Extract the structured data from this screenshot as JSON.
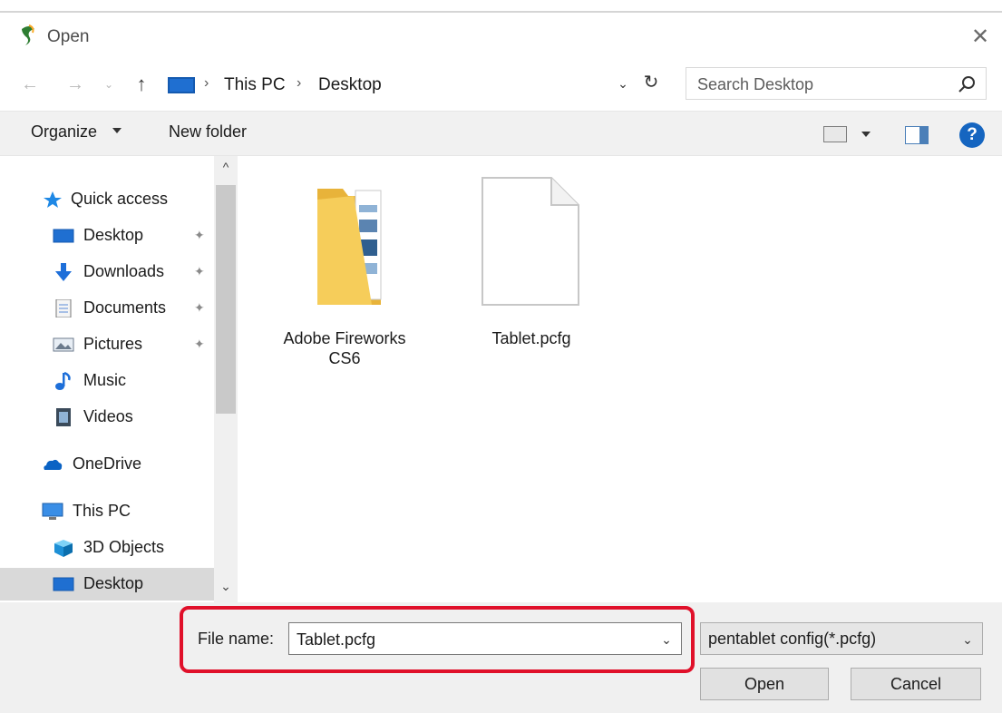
{
  "window": {
    "title": "Open",
    "close_glyph": "✕"
  },
  "nav": {
    "back_glyph": "←",
    "forward_glyph": "→",
    "recent_glyph": "⌄",
    "up_glyph": "↑",
    "breadcrumbs": [
      "This PC",
      "Desktop"
    ],
    "separator": "›",
    "dropdown_glyph": "⌄",
    "refresh_glyph": "↻"
  },
  "search": {
    "placeholder": "Search Desktop"
  },
  "toolbar": {
    "organize_label": "Organize",
    "new_folder_label": "New folder",
    "help_glyph": "?"
  },
  "sidebar": {
    "items": [
      {
        "label": "Quick access",
        "icon": "star-icon"
      },
      {
        "label": "Desktop",
        "icon": "desktop-icon",
        "pinned": true
      },
      {
        "label": "Downloads",
        "icon": "download-icon",
        "pinned": true
      },
      {
        "label": "Documents",
        "icon": "document-icon",
        "pinned": true
      },
      {
        "label": "Pictures",
        "icon": "pictures-icon",
        "pinned": true
      },
      {
        "label": "Music",
        "icon": "music-icon"
      },
      {
        "label": "Videos",
        "icon": "video-icon"
      },
      {
        "label": "OneDrive",
        "icon": "cloud-icon"
      },
      {
        "label": "This PC",
        "icon": "computer-icon"
      },
      {
        "label": "3D Objects",
        "icon": "cube-icon"
      },
      {
        "label": "Desktop",
        "icon": "desktop-icon",
        "selected": true
      }
    ],
    "pin_glyph": "📌"
  },
  "scroll": {
    "up_glyph": "^",
    "down_glyph": "⌄"
  },
  "files": [
    {
      "label": "Adobe Fireworks CS6",
      "type": "folder"
    },
    {
      "label": "Tablet.pcfg",
      "type": "file"
    }
  ],
  "footer": {
    "file_name_label": "File name:",
    "file_name_value": "Tablet.pcfg",
    "file_type": "pentablet config(*.pcfg)",
    "open_label": "Open",
    "cancel_label": "Cancel",
    "dropdown_glyph": "⌄"
  },
  "colors": {
    "highlight": "#e0102a",
    "accent": "#1565c0"
  }
}
